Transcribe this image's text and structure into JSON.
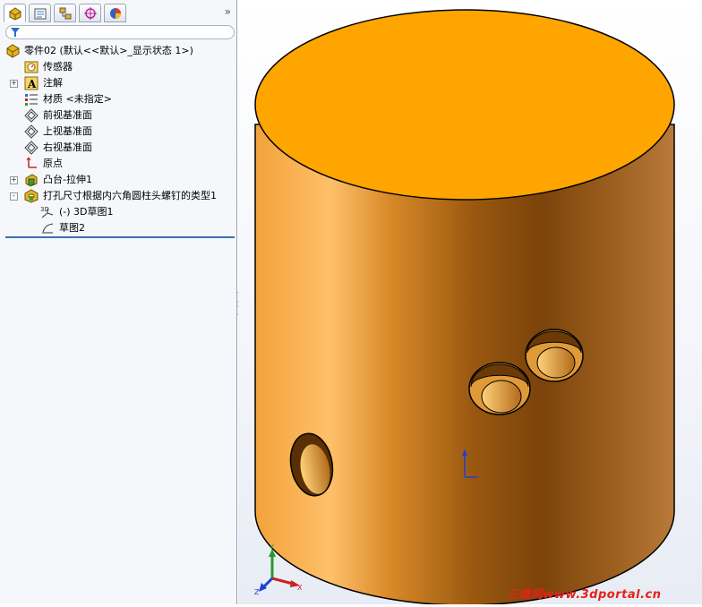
{
  "panel": {
    "tabs": [
      "feature-manager",
      "property-manager",
      "configuration-manager",
      "dimxpert-manager",
      "display-manager"
    ],
    "tabs_overflow": "»"
  },
  "tree": {
    "root": "零件02  (默认<<默认>_显示状态 1>)",
    "items": [
      {
        "label": "传感器",
        "icon": "sensor-icon"
      },
      {
        "label": "注解",
        "icon": "annotation-icon",
        "expander": "+"
      },
      {
        "label": "材质 <未指定>",
        "icon": "material-icon"
      },
      {
        "label": "前视基准面",
        "icon": "plane-icon"
      },
      {
        "label": "上视基准面",
        "icon": "plane-icon"
      },
      {
        "label": "右视基准面",
        "icon": "plane-icon"
      },
      {
        "label": "原点",
        "icon": "origin-icon"
      },
      {
        "label": "凸台-拉伸1",
        "icon": "extrude-icon",
        "expander": "+"
      },
      {
        "label": "打孔尺寸根据内六角圆柱头螺钉的类型1",
        "icon": "hole-wizard-icon",
        "expander": "-"
      }
    ],
    "children": [
      {
        "label": "(-) 3D草图1",
        "icon": "3d-sketch-icon"
      },
      {
        "label": "草图2",
        "icon": "sketch-icon"
      }
    ]
  },
  "viewport": {
    "part_color": "#ffa500",
    "triad_labels": {
      "x": "X",
      "y": "Y",
      "z": "Z"
    }
  },
  "watermark": "三维网www.3dportal.cn"
}
